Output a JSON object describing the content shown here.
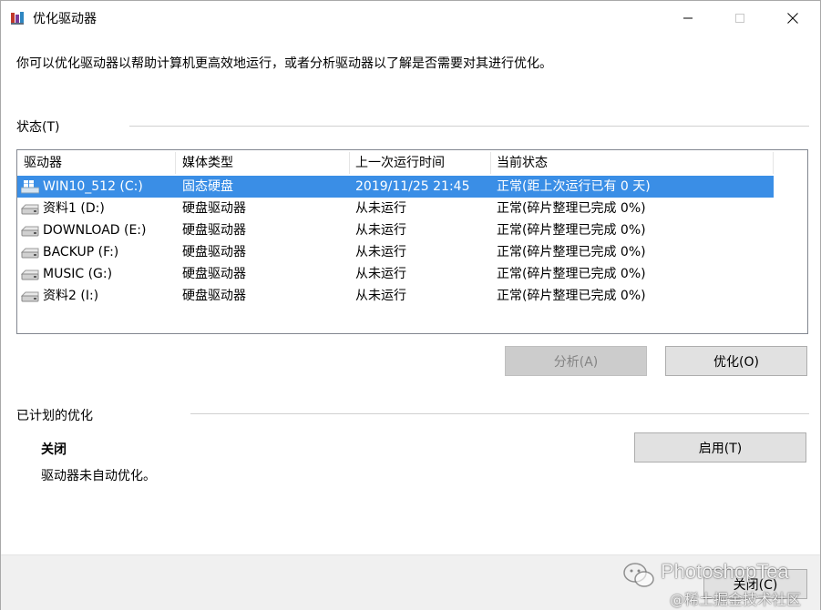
{
  "window": {
    "title": "优化驱动器",
    "icon": "defrag-app-icon"
  },
  "description": "你可以优化驱动器以帮助计算机更高效地运行，或者分析驱动器以了解是否需要对其进行优化。",
  "status_section": {
    "label": "状态(T)",
    "columns": [
      "驱动器",
      "媒体类型",
      "上一次运行时间",
      "当前状态"
    ],
    "rows": [
      {
        "drive": "WIN10_512 (C:)",
        "media": "固态硬盘",
        "last_run": "2019/11/25 21:45",
        "status": "正常(距上次运行已有 0 天)",
        "icon": "windows-drive-icon",
        "selected": true
      },
      {
        "drive": "资料1 (D:)",
        "media": "硬盘驱动器",
        "last_run": "从未运行",
        "status": "正常(碎片整理已完成 0%)",
        "icon": "hard-drive-icon",
        "selected": false
      },
      {
        "drive": "DOWNLOAD (E:)",
        "media": "硬盘驱动器",
        "last_run": "从未运行",
        "status": "正常(碎片整理已完成 0%)",
        "icon": "hard-drive-icon",
        "selected": false
      },
      {
        "drive": "BACKUP (F:)",
        "media": "硬盘驱动器",
        "last_run": "从未运行",
        "status": "正常(碎片整理已完成 0%)",
        "icon": "hard-drive-icon",
        "selected": false
      },
      {
        "drive": "MUSIC (G:)",
        "media": "硬盘驱动器",
        "last_run": "从未运行",
        "status": "正常(碎片整理已完成 0%)",
        "icon": "hard-drive-icon",
        "selected": false
      },
      {
        "drive": "资料2 (I:)",
        "media": "硬盘驱动器",
        "last_run": "从未运行",
        "status": "正常(碎片整理已完成 0%)",
        "icon": "hard-drive-icon",
        "selected": false
      }
    ]
  },
  "actions": {
    "analyze_label": "分析(A)",
    "optimize_label": "优化(O)"
  },
  "scheduled": {
    "label": "已计划的优化",
    "status": "关闭",
    "description": "驱动器未自动优化。",
    "enable_label": "启用(T)"
  },
  "footer": {
    "close_label": "关闭(C)"
  },
  "watermark": {
    "line1": "PhotoshopTea",
    "line2": "@稀土掘金技术社区"
  },
  "colors": {
    "selection": "#3a8ee6",
    "button_face": "#e1e1e1",
    "footer_bg": "#f0f0f0"
  }
}
